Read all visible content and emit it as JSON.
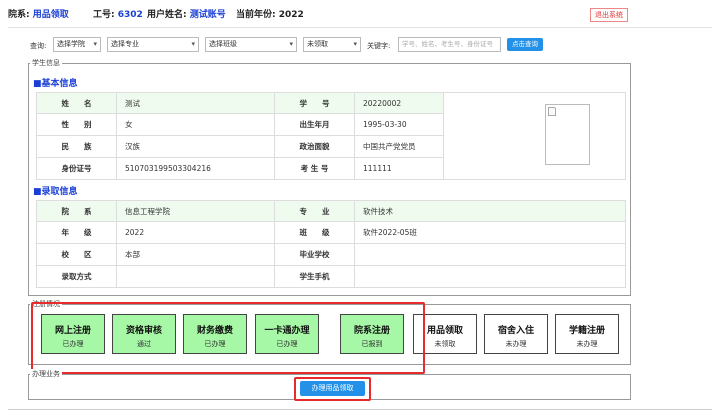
{
  "header": {
    "dept_label": "院系:",
    "dept_value": "用品领取",
    "empno_label": "工号:",
    "empno_value": "6302",
    "username_label": "用户姓名:",
    "username_value": "测试账号",
    "year_label": "当前年份:",
    "year_value": "2022",
    "logout_label": "退出系统"
  },
  "filter": {
    "query_label": "查询:",
    "school_select": "选择学院",
    "major_select": "选择专业",
    "class_select": "选择班级",
    "status_select": "未领取",
    "keyword_label": "关键字:",
    "keyword_placeholder": "学号、姓名、考生号、身份证号",
    "query_button": "点击查询"
  },
  "student_panel": {
    "legend": "学生信息",
    "basic_title": "■基本信息",
    "basic_rows": [
      {
        "l1": "姓　　名",
        "v1": "测试",
        "l2": "学　　号",
        "v2": "20220002"
      },
      {
        "l1": "性　　别",
        "v1": "女",
        "l2": "出生年月",
        "v2": "1995-03-30"
      },
      {
        "l1": "民　　族",
        "v1": "汉族",
        "l2": "政治面貌",
        "v2": "中国共产党党员"
      },
      {
        "l1": "身份证号",
        "v1": "510703199503304216",
        "l2": "考 生 号",
        "v2": "111111"
      }
    ],
    "admission_title": "■录取信息",
    "admission_rows": [
      {
        "l1": "院　　系",
        "v1": "信息工程学院",
        "l2": "专　　业",
        "v2": "软件技术"
      },
      {
        "l1": "年　　级",
        "v1": "2022",
        "l2": "班　　级",
        "v2": "软件2022-05班"
      },
      {
        "l1": "校　　区",
        "v1": "本部",
        "l2": "毕业学校",
        "v2": ""
      },
      {
        "l1": "录取方式",
        "v1": "",
        "l2": "学生手机",
        "v2": ""
      }
    ]
  },
  "registration": {
    "legend": "注册情况",
    "steps": [
      {
        "title": "网上注册",
        "status": "已办理",
        "done": true
      },
      {
        "title": "资格审核",
        "status": "通过",
        "done": true
      },
      {
        "title": "财务缴费",
        "status": "已办理",
        "done": true
      },
      {
        "title": "一卡通办理",
        "status": "已办理",
        "done": true
      },
      {
        "title": "院系注册",
        "status": "已报到",
        "done": true
      },
      {
        "title": "用品领取",
        "status": "未领取",
        "done": false
      },
      {
        "title": "宿舍入住",
        "status": "未办理",
        "done": false
      },
      {
        "title": "学籍注册",
        "status": "未办理",
        "done": false
      }
    ]
  },
  "business": {
    "legend": "办理业务",
    "action_button": "办理用品领取"
  },
  "colors": {
    "accent_blue": "#1a3fd6",
    "button_blue": "#2491e8",
    "done_green": "#a6f7a6",
    "highlight_red": "#e52b2b"
  }
}
